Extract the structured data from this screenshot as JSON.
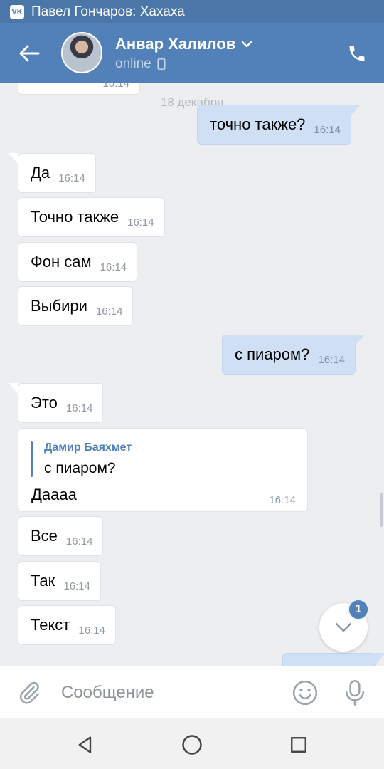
{
  "status_bar": {
    "notification_text": "Павел Гончаров: Хахаха",
    "app_icon": "vk-logo-icon"
  },
  "header": {
    "contact_name": "Анвар Халилов",
    "status": "online",
    "status_icon": "mobile-phone-icon",
    "back_icon": "arrow-left-icon",
    "call_icon": "phone-icon",
    "accent_color": "#5181b8"
  },
  "chat": {
    "partial_top_time": "16:14",
    "date_separator": "18 декабря",
    "messages": [
      {
        "direction": "out",
        "text": "точно также?",
        "time": "16:14"
      },
      {
        "direction": "in",
        "text": "Да",
        "time": "16:14"
      },
      {
        "direction": "in",
        "text": "Точно также",
        "time": "16:14"
      },
      {
        "direction": "in",
        "text": "Фон сам",
        "time": "16:14"
      },
      {
        "direction": "in",
        "text": "Выбири",
        "time": "16:14"
      },
      {
        "direction": "out",
        "text": "с пиаром?",
        "time": "16:14"
      },
      {
        "direction": "in",
        "text": "Это",
        "time": "16:14"
      },
      {
        "direction": "in",
        "reply_to_author": "Дамир Баяхмет",
        "reply_to_text": "с пиаром?",
        "text": "Даааа",
        "time": "16:14"
      },
      {
        "direction": "in",
        "text": "Все",
        "time": "16:14"
      },
      {
        "direction": "in",
        "text": "Так",
        "time": "16:14"
      },
      {
        "direction": "in",
        "text": "Текст",
        "time": "16:14"
      }
    ],
    "unread_count": "1",
    "scroll_down_icon": "chevron-down-icon"
  },
  "composer": {
    "placeholder": "Сообщение",
    "attach_icon": "paperclip-icon",
    "emoji_icon": "smiley-icon",
    "mic_icon": "microphone-icon"
  },
  "nav": {
    "back_icon": "triangle-back-icon",
    "home_icon": "circle-home-icon",
    "recents_icon": "square-recents-icon"
  }
}
